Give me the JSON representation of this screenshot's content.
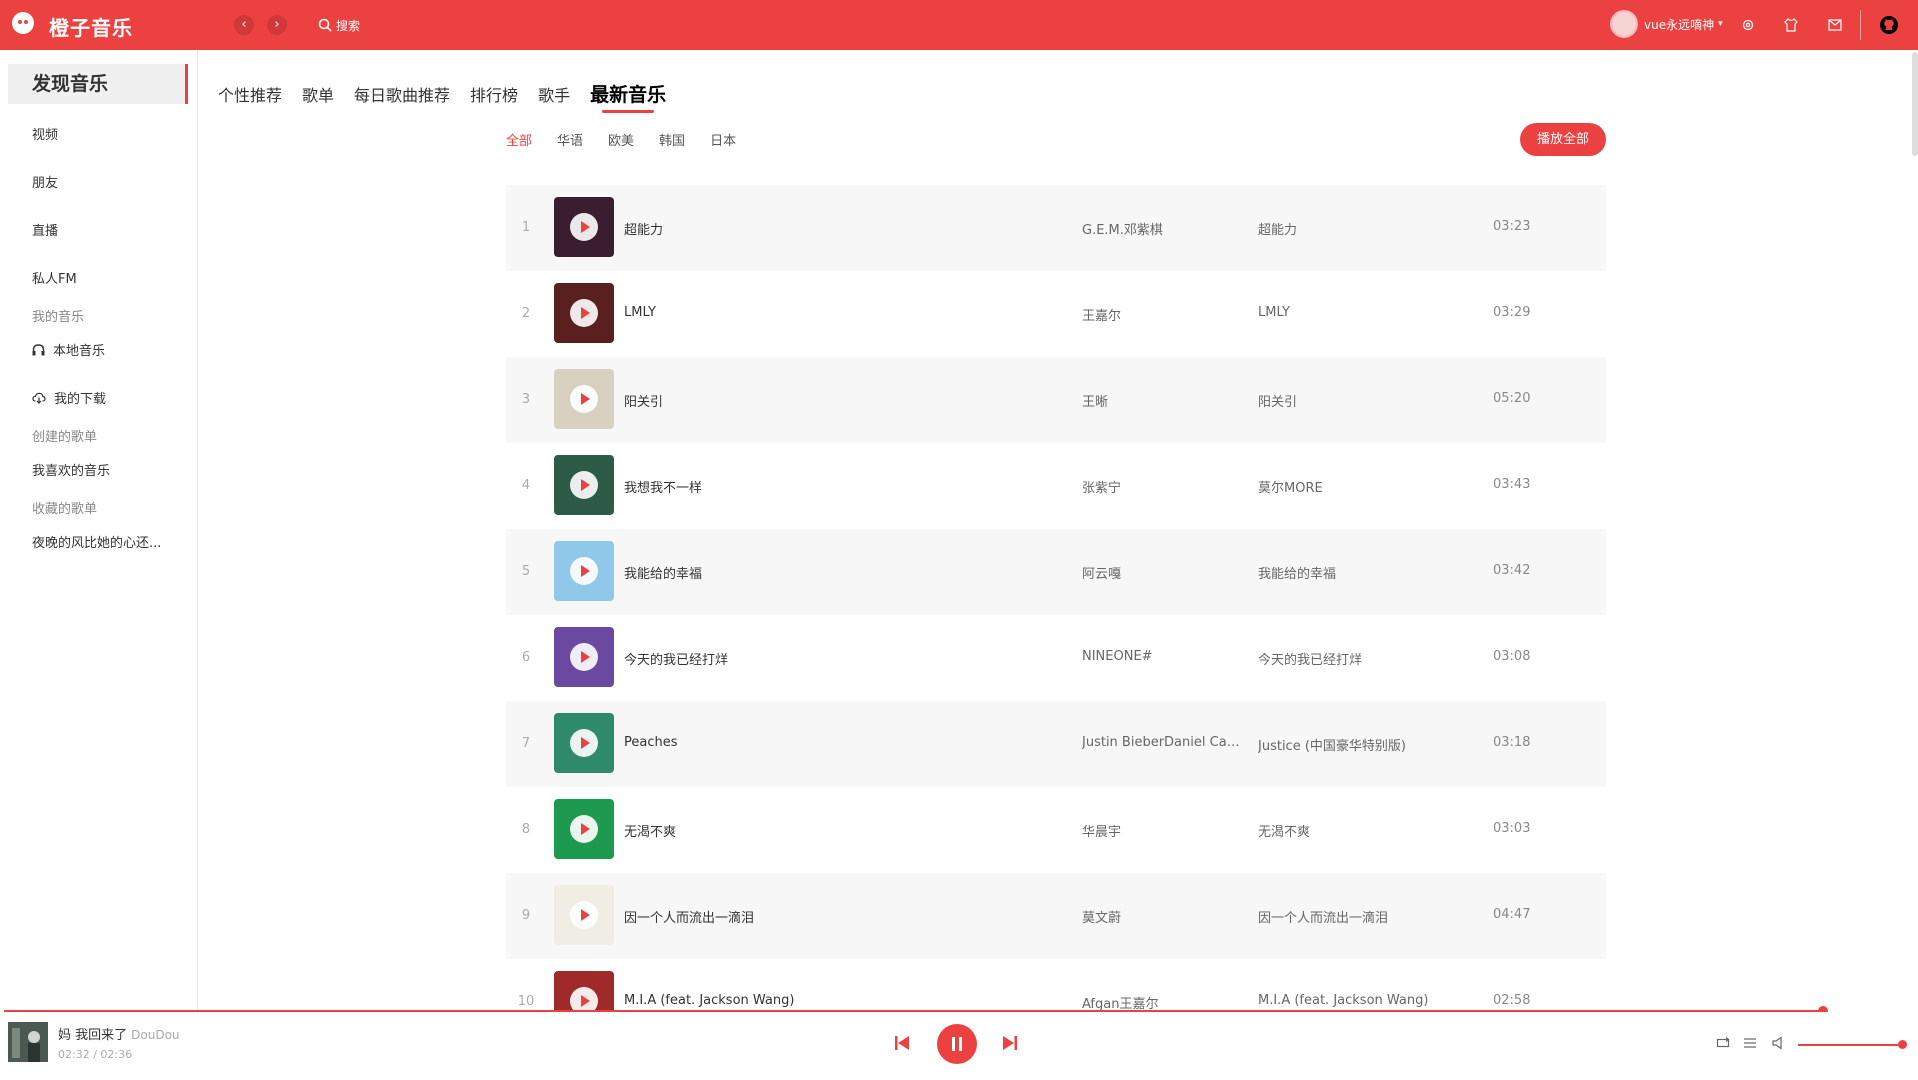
{
  "header": {
    "app_title": "橙子音乐",
    "back_icon": "‹",
    "forward_icon": "›",
    "search_label": "搜索",
    "username": "vue永远嘀神",
    "caret": "▾",
    "accent_color": "#ec4141"
  },
  "sidebar": {
    "active": "发现音乐",
    "items": [
      "视频",
      "朋友",
      "直播",
      "私人FM"
    ],
    "my_music_label": "我的音乐",
    "local_music": "本地音乐",
    "downloads": "我的下载",
    "created_playlists_label": "创建的歌单",
    "liked_music": "我喜欢的音乐",
    "collected_playlists_label": "收藏的歌单",
    "collected_playlist": "夜晚的风比她的心还..."
  },
  "tabs": [
    "个性推荐",
    "歌单",
    "每日歌曲推荐",
    "排行榜",
    "歌手",
    "最新音乐"
  ],
  "active_tab": "最新音乐",
  "subtabs": [
    "全部",
    "华语",
    "欧美",
    "韩国",
    "日本"
  ],
  "active_subtab": "全部",
  "play_all_label": "播放全部",
  "songs": [
    {
      "num": "1",
      "name": "超能力",
      "artist": "G.E.M.邓紫棋",
      "album": "超能力",
      "duration": "03:23",
      "cover": "#3a1d2e"
    },
    {
      "num": "2",
      "name": "LMLY",
      "artist": "王嘉尔",
      "album": "LMLY",
      "duration": "03:29",
      "cover": "#5a2020"
    },
    {
      "num": "3",
      "name": "阳关引",
      "artist": "王晰",
      "album": "阳关引",
      "duration": "05:20",
      "cover": "#d8d0c0"
    },
    {
      "num": "4",
      "name": "我想我不一样",
      "artist": "张紫宁",
      "album": "莫尔MORE",
      "duration": "03:43",
      "cover": "#2e5a48"
    },
    {
      "num": "5",
      "name": "我能给的幸福",
      "artist": "阿云嘎",
      "album": "我能给的幸福",
      "duration": "03:42",
      "cover": "#8fc8e8"
    },
    {
      "num": "6",
      "name": "今天的我已经打烊",
      "artist": "NINEONE#",
      "album": "今天的我已经打烊",
      "duration": "03:08",
      "cover": "#6a4aa0"
    },
    {
      "num": "7",
      "name": "Peaches",
      "artist": "Justin BieberDaniel Caesar",
      "album": "Justice (中国豪华特别版)",
      "duration": "03:18",
      "cover": "#2e8a6a"
    },
    {
      "num": "8",
      "name": "无渴不爽",
      "artist": "华晨宇",
      "album": "无渴不爽",
      "duration": "03:03",
      "cover": "#1e9a50"
    },
    {
      "num": "9",
      "name": "因一个人而流出一滴泪",
      "artist": "莫文蔚",
      "album": "因一个人而流出一滴泪",
      "duration": "04:47",
      "cover": "#f0ede4"
    },
    {
      "num": "10",
      "name": "M.I.A (feat. Jackson Wang)",
      "artist": "Afgan王嘉尔",
      "album": "M.I.A (feat. Jackson Wang)",
      "duration": "02:58",
      "cover": "#a02a2a"
    }
  ],
  "player": {
    "song_name": "妈 我回来了",
    "artist": "DouDou",
    "time": "02:32 / 02:36",
    "progress": 0.98,
    "volume": 1.0
  }
}
